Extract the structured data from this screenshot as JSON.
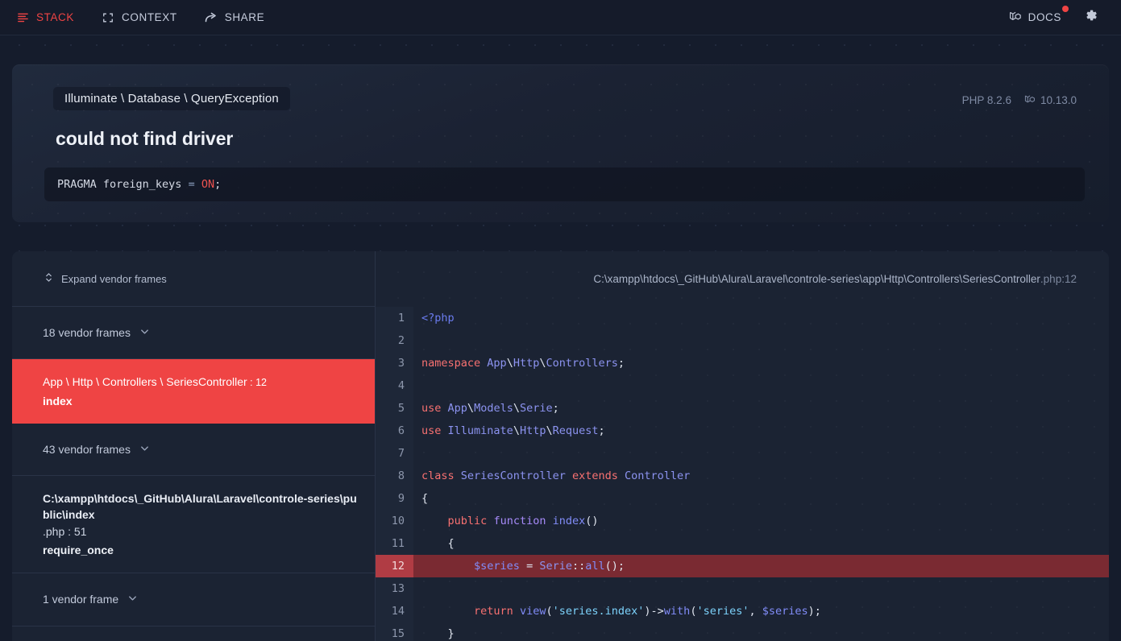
{
  "topbar": {
    "nav": [
      {
        "label": "STACK",
        "icon": "list-icon",
        "active": true
      },
      {
        "label": "CONTEXT",
        "icon": "brackets-icon",
        "active": false
      },
      {
        "label": "SHARE",
        "icon": "share-arrow-icon",
        "active": false
      }
    ],
    "docs_label": "DOCS",
    "docs_icon": "laravel-logo-icon",
    "settings_icon": "gear-icon",
    "accent_color": "#ef4444"
  },
  "exception": {
    "class": "Illuminate \\ Database \\ QueryException",
    "message": "could not find driver",
    "php_version": "PHP 8.2.6",
    "laravel_version": "10.13.0",
    "query": {
      "prefix": "PRAGMA foreign_keys ",
      "operator": "=",
      "value": " ON",
      "suffix": ";"
    }
  },
  "frames": {
    "expand_label": "Expand vendor frames",
    "expand_icon": "chevron-up-down-icon",
    "items": [
      {
        "type": "vendor",
        "label": "18 vendor frames",
        "icon": "chevron-down-icon"
      },
      {
        "type": "app",
        "title": "App \\ Http \\ Controllers \\ SeriesController",
        "line": "12",
        "fn": "index",
        "active": true
      },
      {
        "type": "vendor",
        "label": "43 vendor frames",
        "icon": "chevron-down-icon"
      },
      {
        "type": "app",
        "path": "C:\\xampp\\htdocs\\_GitHub\\Alura\\Laravel\\controle-series\\public\\index",
        "ext": ".php",
        "line": "51",
        "fn": "require_once",
        "active": false
      },
      {
        "type": "vendor",
        "label": "1 vendor frame",
        "icon": "chevron-down-icon"
      }
    ]
  },
  "code": {
    "file_path": "C:\\xampp\\htdocs\\_GitHub\\Alura\\Laravel\\controle-series\\app\\Http\\Controllers\\SeriesController",
    "file_ext": ".php",
    "file_line": "12",
    "highlight_line": 12,
    "lines": [
      {
        "n": 1,
        "text": "<?php"
      },
      {
        "n": 2,
        "text": ""
      },
      {
        "n": 3,
        "text": "namespace App\\Http\\Controllers;"
      },
      {
        "n": 4,
        "text": ""
      },
      {
        "n": 5,
        "text": "use App\\Models\\Serie;"
      },
      {
        "n": 6,
        "text": "use Illuminate\\Http\\Request;"
      },
      {
        "n": 7,
        "text": ""
      },
      {
        "n": 8,
        "text": "class SeriesController extends Controller"
      },
      {
        "n": 9,
        "text": "{"
      },
      {
        "n": 10,
        "text": "    public function index()"
      },
      {
        "n": 11,
        "text": "    {"
      },
      {
        "n": 12,
        "text": "        $series = Serie::all();"
      },
      {
        "n": 13,
        "text": ""
      },
      {
        "n": 14,
        "text": "        return view('series.index')->with('series', $series);"
      },
      {
        "n": 15,
        "text": "    }"
      }
    ]
  }
}
